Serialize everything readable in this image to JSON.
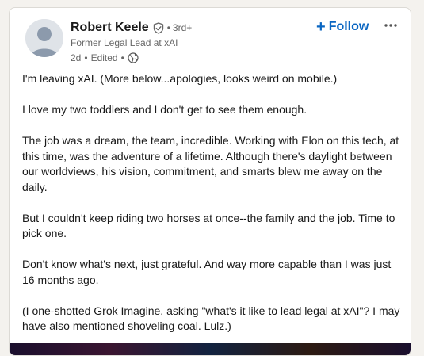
{
  "post": {
    "author": {
      "name": "Robert Keele",
      "degree": "3rd+",
      "headline": "Former Legal Lead at xAI",
      "time": "2d",
      "edited": "Edited"
    },
    "actions": {
      "follow_label": "Follow",
      "follow_icon": "plus-icon",
      "more_icon": "ellipsis-icon"
    },
    "body": [
      "I'm leaving xAI. (More below...apologies, looks weird on mobile.)",
      "I love my two toddlers and I don't get to see them enough.",
      "The job was a dream, the team, incredible. Working with Elon on this tech, at this time, was the adventure of a lifetime. Although there's daylight between our worldviews, his vision, commitment, and smarts blew me away on the daily.",
      "But I couldn't keep riding two horses at once--the family and the job. Time to pick one.",
      "Don't know what's next, just grateful. And way more capable than I was just 16 months ago.",
      "(I one-shotted Grok Imagine, asking \"what's it like to lead legal at xAI\"? I may have also mentioned shoveling coal. Lulz.)"
    ]
  },
  "colors": {
    "accent": "#0a66c2",
    "text_primary": "#191919",
    "text_secondary": "#666666",
    "card_bg": "#ffffff",
    "page_bg": "#f4f2ee"
  }
}
